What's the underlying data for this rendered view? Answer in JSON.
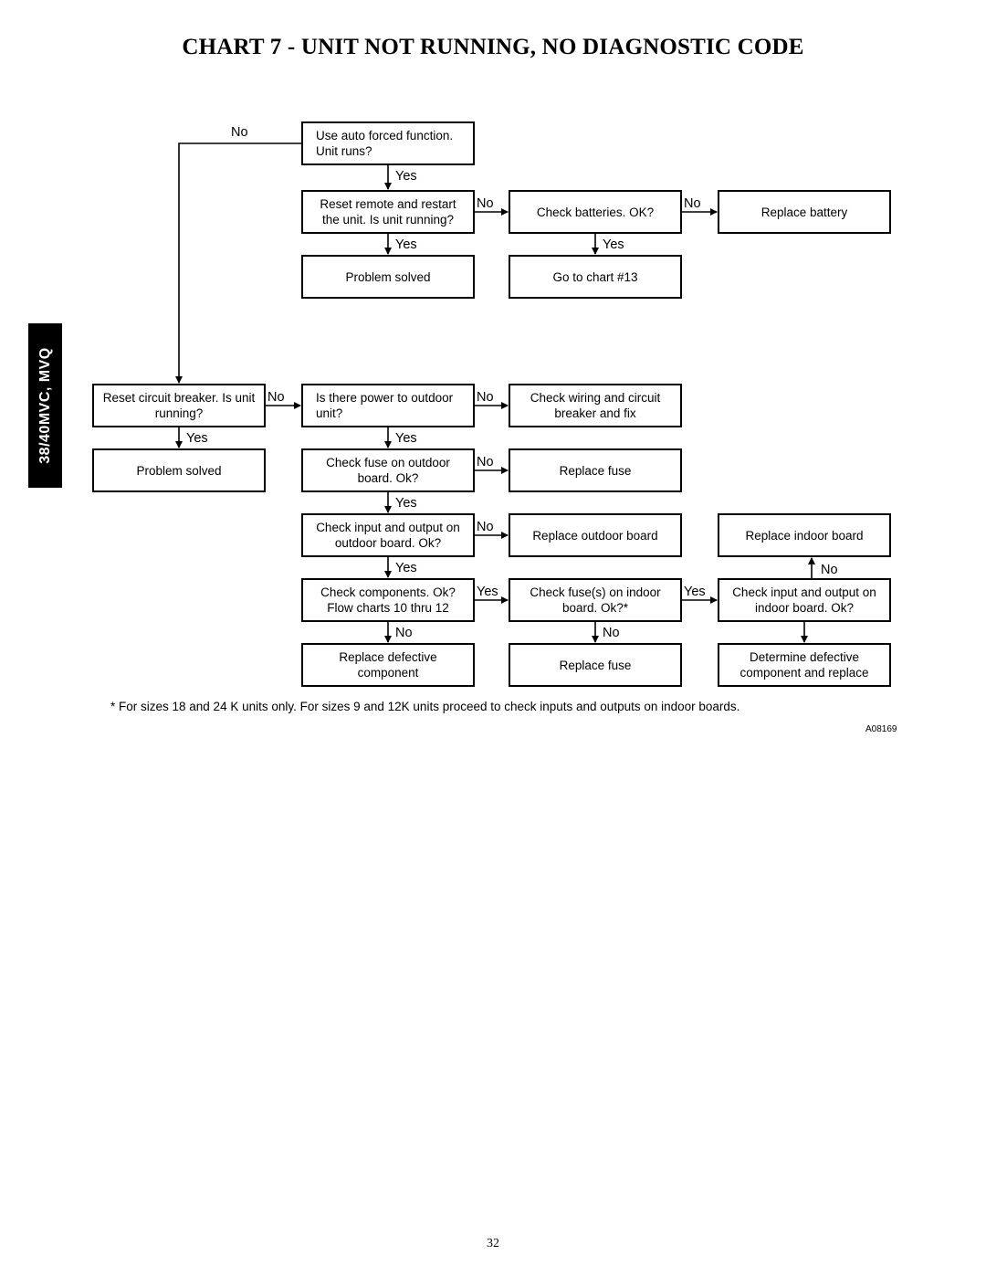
{
  "page": {
    "title": "CHART 7 - UNIT NOT RUNNING, NO DIAGNOSTIC CODE",
    "side_tab": "38/40MVC, MVQ",
    "footnote": "* For sizes 18 and 24 K units only. For sizes 9 and 12K units proceed to check inputs and outputs on indoor boards.",
    "figure_id": "A08169",
    "page_number": "32"
  },
  "flowchart": {
    "nodes": [
      {
        "id": "auto_forced",
        "text": "Use auto forced function.\nUnit runs?",
        "align": "left"
      },
      {
        "id": "reset_remote",
        "text": "Reset remote and restart\nthe unit. Is unit running?"
      },
      {
        "id": "check_batteries",
        "text": "Check batteries. OK?"
      },
      {
        "id": "replace_battery",
        "text": "Replace battery"
      },
      {
        "id": "problem_solved_1",
        "text": "Problem solved"
      },
      {
        "id": "go_chart_13",
        "text": "Go to chart #13"
      },
      {
        "id": "reset_breaker",
        "text": "Reset circuit breaker. Is unit\nrunning?"
      },
      {
        "id": "power_outdoor",
        "text": "Is there power to outdoor\nunit?",
        "align": "left"
      },
      {
        "id": "check_wiring",
        "text": "Check wiring and circuit\nbreaker and fix"
      },
      {
        "id": "problem_solved_2",
        "text": "Problem solved"
      },
      {
        "id": "check_fuse_outdoor",
        "text": "Check fuse on outdoor\nboard. Ok?"
      },
      {
        "id": "replace_fuse_1",
        "text": "Replace fuse"
      },
      {
        "id": "check_io_outdoor",
        "text": "Check input and output on\noutdoor board. Ok?"
      },
      {
        "id": "replace_outdoor_board",
        "text": "Replace outdoor board"
      },
      {
        "id": "replace_indoor_board",
        "text": "Replace indoor board"
      },
      {
        "id": "check_components",
        "text": "Check components. Ok?\nFlow charts 10 thru 12"
      },
      {
        "id": "check_fuse_indoor",
        "text": "Check fuse(s) on indoor\nboard. Ok?*"
      },
      {
        "id": "check_io_indoor",
        "text": "Check input and output on\nindoor board. Ok?"
      },
      {
        "id": "replace_defective",
        "text": "Replace defective\ncomponent"
      },
      {
        "id": "replace_fuse_2",
        "text": "Replace fuse"
      },
      {
        "id": "determine_defective",
        "text": "Determine defective\ncomponent and replace"
      }
    ],
    "edges": [
      {
        "from": "auto_forced",
        "to": "reset_remote",
        "label": "Yes"
      },
      {
        "from": "auto_forced",
        "to": "reset_breaker",
        "label": "No"
      },
      {
        "from": "reset_remote",
        "to": "check_batteries",
        "label": "No"
      },
      {
        "from": "reset_remote",
        "to": "problem_solved_1",
        "label": "Yes"
      },
      {
        "from": "check_batteries",
        "to": "replace_battery",
        "label": "No"
      },
      {
        "from": "check_batteries",
        "to": "go_chart_13",
        "label": "Yes"
      },
      {
        "from": "reset_breaker",
        "to": "power_outdoor",
        "label": "No"
      },
      {
        "from": "reset_breaker",
        "to": "problem_solved_2",
        "label": "Yes"
      },
      {
        "from": "power_outdoor",
        "to": "check_wiring",
        "label": "No"
      },
      {
        "from": "power_outdoor",
        "to": "check_fuse_outdoor",
        "label": "Yes"
      },
      {
        "from": "check_fuse_outdoor",
        "to": "replace_fuse_1",
        "label": "No"
      },
      {
        "from": "check_fuse_outdoor",
        "to": "check_io_outdoor",
        "label": "Yes"
      },
      {
        "from": "check_io_outdoor",
        "to": "replace_outdoor_board",
        "label": "No"
      },
      {
        "from": "check_io_outdoor",
        "to": "check_components",
        "label": "Yes"
      },
      {
        "from": "check_components",
        "to": "check_fuse_indoor",
        "label": "Yes"
      },
      {
        "from": "check_components",
        "to": "replace_defective",
        "label": "No"
      },
      {
        "from": "check_fuse_indoor",
        "to": "check_io_indoor",
        "label": "Yes"
      },
      {
        "from": "check_fuse_indoor",
        "to": "replace_fuse_2",
        "label": "No"
      },
      {
        "from": "check_io_indoor",
        "to": "replace_indoor_board",
        "label": "No"
      },
      {
        "from": "check_io_indoor",
        "to": "determine_defective",
        "label": ""
      }
    ]
  }
}
